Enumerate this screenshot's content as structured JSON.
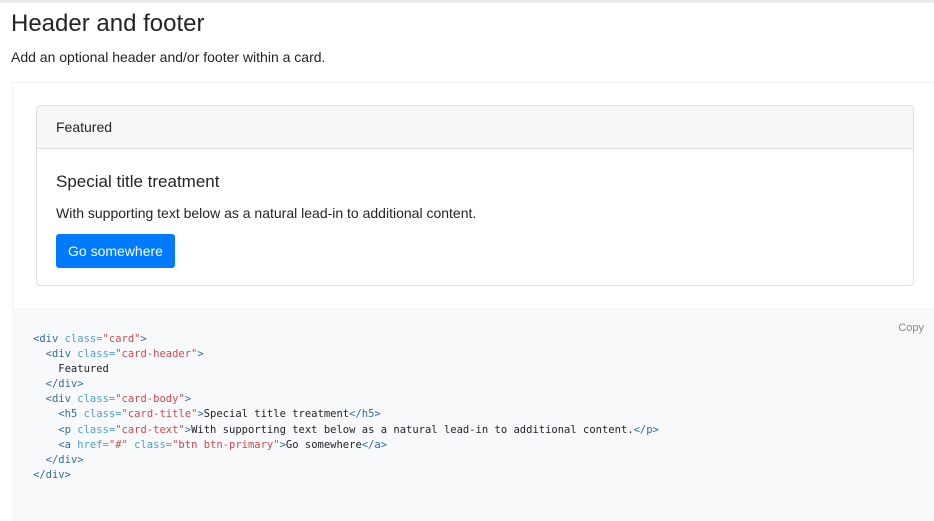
{
  "section": {
    "title": "Header and footer",
    "lead": "Add an optional header and/or footer within a card."
  },
  "card": {
    "header": "Featured",
    "title": "Special title treatment",
    "text": "With supporting text below as a natural lead-in to additional content.",
    "button_label": "Go somewhere"
  },
  "code": {
    "copy_label": "Copy",
    "lines": [
      [
        [
          "tag",
          "<div "
        ],
        [
          "attr",
          "class="
        ],
        [
          "str",
          "\"card\""
        ],
        [
          "tag",
          ">"
        ]
      ],
      [
        [
          "txt",
          "  "
        ],
        [
          "tag",
          "<div "
        ],
        [
          "attr",
          "class="
        ],
        [
          "str",
          "\"card-header\""
        ],
        [
          "tag",
          ">"
        ]
      ],
      [
        [
          "txt",
          "    Featured"
        ]
      ],
      [
        [
          "txt",
          "  "
        ],
        [
          "tag",
          "</div>"
        ]
      ],
      [
        [
          "txt",
          "  "
        ],
        [
          "tag",
          "<div "
        ],
        [
          "attr",
          "class="
        ],
        [
          "str",
          "\"card-body\""
        ],
        [
          "tag",
          ">"
        ]
      ],
      [
        [
          "txt",
          "    "
        ],
        [
          "tag",
          "<h5 "
        ],
        [
          "attr",
          "class="
        ],
        [
          "str",
          "\"card-title\""
        ],
        [
          "tag",
          ">"
        ],
        [
          "txt",
          "Special title treatment"
        ],
        [
          "tag",
          "</h5>"
        ]
      ],
      [
        [
          "txt",
          "    "
        ],
        [
          "tag",
          "<p "
        ],
        [
          "attr",
          "class="
        ],
        [
          "str",
          "\"card-text\""
        ],
        [
          "tag",
          ">"
        ],
        [
          "txt",
          "With supporting text below as a natural lead-in to additional content."
        ],
        [
          "tag",
          "</p>"
        ]
      ],
      [
        [
          "txt",
          "    "
        ],
        [
          "tag",
          "<a "
        ],
        [
          "attr",
          "href="
        ],
        [
          "str",
          "\"#\""
        ],
        [
          "attr",
          " class="
        ],
        [
          "str",
          "\"btn btn-primary\""
        ],
        [
          "tag",
          ">"
        ],
        [
          "txt",
          "Go somewhere"
        ],
        [
          "tag",
          "</a>"
        ]
      ],
      [
        [
          "txt",
          "  "
        ],
        [
          "tag",
          "</div>"
        ]
      ],
      [
        [
          "tag",
          "</div>"
        ]
      ]
    ]
  },
  "colors": {
    "primary": "#007bff",
    "code_tag": "#2f6f9f",
    "code_attr": "#4f9fcf",
    "code_string": "#d44950"
  }
}
